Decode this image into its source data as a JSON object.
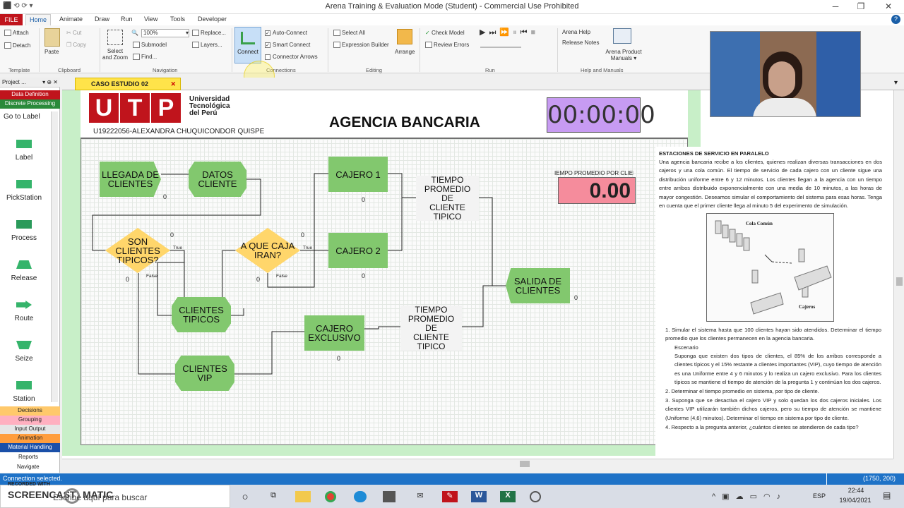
{
  "window": {
    "title": "Arena Training & Evaluation Mode (Student) - Commercial Use Prohibited",
    "min": "─",
    "max": "❐",
    "close": "✕"
  },
  "ribbon_tabs": [
    "FILE",
    "Home",
    "Animate",
    "Draw",
    "Run",
    "View",
    "Tools",
    "Developer"
  ],
  "ribbon": {
    "attach": "Attach",
    "detach": "Detach",
    "paste": "Paste",
    "cut": "Cut",
    "copy": "Copy",
    "template": "Template",
    "clipboard": "Clipboard",
    "select_zoom": "Select\nand Zoom",
    "zoom": "100%",
    "submodel": "Submodel",
    "find": "Find...",
    "replace": "Replace...",
    "layers": "Layers...",
    "navigation": "Navigation",
    "connect": "Connect",
    "auto_connect": "Auto-Connect",
    "smart_connect": "Smart Connect",
    "connector_arrows": "Connector Arrows",
    "connections": "Connections",
    "select_all": "Select All",
    "expression_builder": "Expression Builder",
    "arrange": "Arrange",
    "editing": "Editing",
    "check_model": "Check Model",
    "review_errors": "Review Errors",
    "run": "Run",
    "arena_help": "Arena Help",
    "release_notes": "Release Notes",
    "product_manuals": "Arena Product Manuals",
    "help_manuals": "Help and Manuals"
  },
  "project": {
    "title": "Project ...",
    "panels": [
      {
        "label": "Data Definition",
        "color": "#c0141c",
        "fg": "#ffffff"
      },
      {
        "label": "Discrete Processing",
        "color": "#2a8a3a",
        "fg": "#ffffff"
      }
    ],
    "goto": "Go to Label",
    "modules": [
      "Label",
      "PickStation",
      "Process",
      "Release",
      "Route",
      "Seize",
      "Station"
    ],
    "bottom_panels": [
      {
        "label": "Decisions",
        "color": "#ffc96b"
      },
      {
        "label": "Grouping",
        "color": "#ffb0c0"
      },
      {
        "label": "Input Output",
        "color": "#e6e6e6"
      },
      {
        "label": "Animation",
        "color": "#ff9d3d"
      },
      {
        "label": "Material Handling",
        "color": "#1a4fa8"
      }
    ],
    "reports": "Reports",
    "navigate": "Navigate"
  },
  "doc_tab": "CASO ESTUDIO 02",
  "header": {
    "uni": "Universidad\nTecnológica\ndel Perú",
    "student": "U19222056-ALEXANDRA CHUQUICONDOR QUISPE",
    "title": "AGENCIA BANCARIA",
    "clock": "00:00:00",
    "avg_label": "IEMPO PROMEDIO POR CLIENTI",
    "avg_value": "0.00"
  },
  "flow": {
    "llegada": "LLEGADA DE\nCLIENTES",
    "datos": "DATOS\nCLIENTE",
    "son": "SON\nCLIENTES\nTIPICOS?",
    "que": "A QUE CAJA\nIRAN?",
    "cajero1": "CAJERO 1",
    "cajero2": "CAJERO 2",
    "tiempo1": "TIEMPO\nPROMEDIO\nDE\nCLIENTE\nTIPICO",
    "salida": "SALIDA DE\nCLIENTES",
    "tipicos": "CLIENTES\nTIPICOS",
    "exclusivo": "CAJERO\nEXCLUSIVO",
    "tiempo2": "TIEMPO\nPROMEDIO\nDE\nCLIENTE\nTIPICO",
    "vip": "CLIENTES\nVIP",
    "true": "True",
    "false": "False",
    "zero": "0"
  },
  "case": {
    "heading": "ESTACIONES DE SERVICIO EN PARALELO",
    "body": "Una agencia bancaria recibe a los clientes, quienes realizan diversas transacciones en dos cajeros y una cola común. El tiempo de servicio de cada cajero con un cliente sigue una distribución uniforme entre 6 y 12 minutos. Los clientes llegan a la agencia con un tiempo entre arribos distribuido exponencialmente con una media de 10 minutos, a las horas de mayor congestión. Deseamos simular el comportamiento del sistema para esas horas. Tenga en cuenta que el primer cliente llega al minuto 5 del experimento de simulación.",
    "fig_cola": "Cola Común",
    "fig_cajeros": "Cajeros",
    "items": [
      "1. Simular el sistema hasta que 100 clientes hayan sido atendidos. Determinar el tiempo promedio que los clientes permanecen en la agencia bancaria.",
      "Escenario",
      "Suponga que existen dos tipos de clientes, el 85% de los arribos corresponde a clientes típicos y el 15% restante a clientes importantes (VIP), cuyo tiempo de atención es una Uniforme entre 4 y 6 minutos y lo realiza un cajero exclusivo. Para los clientes típicos se mantiene el tiempo de atención de la pregunta 1 y continúan los dos cajeros.",
      "2. Determinar el tiempo promedio en sistema, por tipo de cliente.",
      "3. Suponga que se desactiva el cajero VIP y solo quedan los dos cajeros iniciales. Los clientes VIP utilizarán también dichos cajeros, pero su tiempo de atención se mantiene (Uniforme (4,6) minutos). Determinar el tiempo en sistema por tipo de cliente.",
      "4. Respecto a la pregunta anterior, ¿cuántos clientes se atendieron de cada tipo?"
    ]
  },
  "status": {
    "left": "Connection selected.",
    "coords": "(1750, 200)"
  },
  "taskbar": {
    "search": "Escribe aquí para buscar",
    "watermark": "RECORDED WITH",
    "watermark2": "SCREENCAST",
    "watermark3": "MATIC",
    "lang": "ESP",
    "time": "22:44",
    "date": "19/04/2021"
  }
}
